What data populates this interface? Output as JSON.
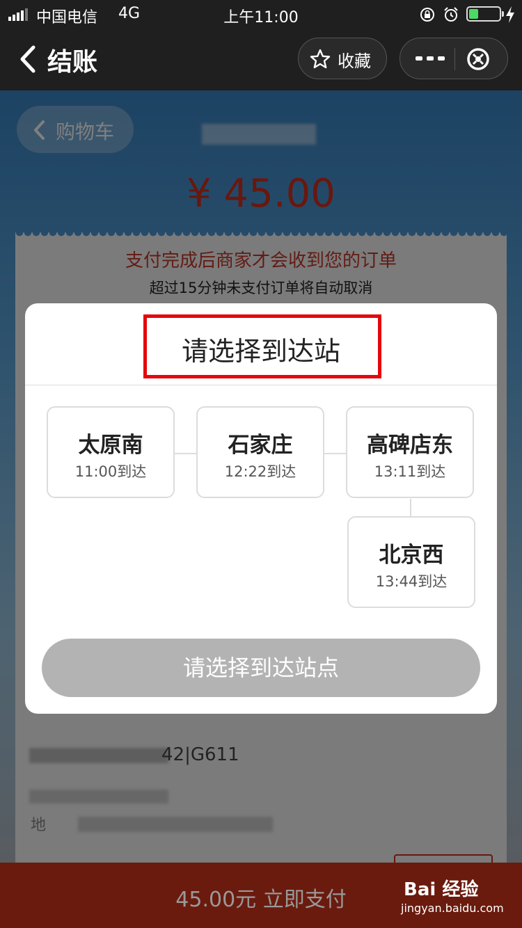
{
  "status_bar": {
    "carrier": "中国电信",
    "network": "4G",
    "time": "上午11:00",
    "battery_level": 0.3,
    "icons": [
      "signal-icon",
      "lock-rotation-icon",
      "alarm-icon",
      "battery-icon",
      "charging-icon"
    ]
  },
  "nav": {
    "title": "结账",
    "favorite_label": "收藏",
    "icons": [
      "back-arrow-icon",
      "star-icon",
      "more-icon",
      "close-mini-program-icon"
    ]
  },
  "checkout": {
    "cart_label": "购物车",
    "price": "¥ 45.00",
    "warning": "支付完成后商家才会收到您的订单",
    "note": "超过15分钟未支付订单将自动取消",
    "train_line": "42|G611",
    "address_label": "地"
  },
  "modal": {
    "title": "请选择到达站",
    "stations": [
      {
        "name": "太原南",
        "time": "11:00到达"
      },
      {
        "name": "石家庄",
        "time": "12:22到达"
      },
      {
        "name": "高碑店东",
        "time": "13:11到达"
      },
      {
        "name": "北京西",
        "time": "13:44到达"
      }
    ],
    "confirm_label": "请选择到达站点"
  },
  "bottom_bar": {
    "pay_label": "45.00元 立即支付"
  },
  "watermark": {
    "brand": "Bai 经验",
    "url": "jingyan.baidu.com"
  },
  "colors": {
    "accent_red": "#e5060c",
    "price_red": "#d0311f",
    "pay_bar": "#6a1b0e"
  }
}
